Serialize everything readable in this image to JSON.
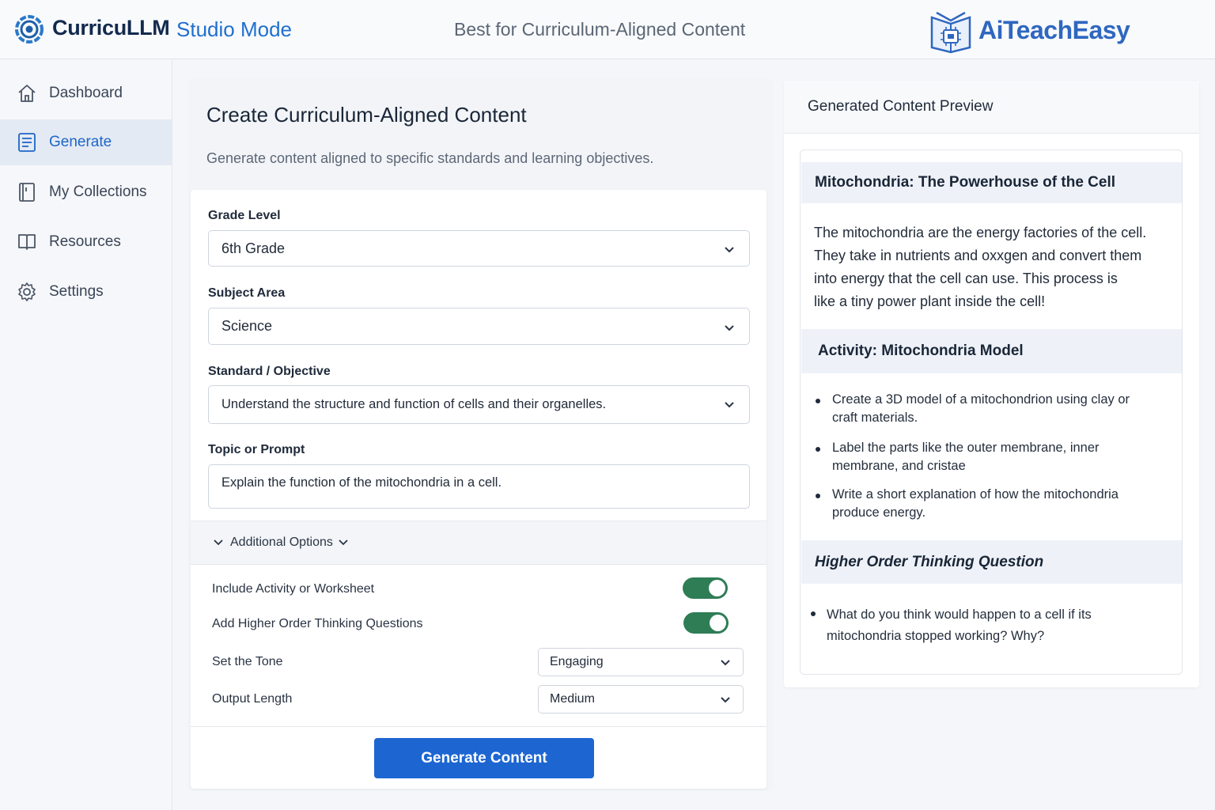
{
  "header": {
    "brand": "CurricuLLM",
    "mode": "Studio Mode",
    "tagline": "Best for Curriculum-Aligned Content",
    "partner": "AiTeachEasy"
  },
  "sidebar": {
    "items": [
      {
        "label": "Dashboard",
        "icon": "home-icon"
      },
      {
        "label": "Generate",
        "icon": "document-icon",
        "active": true
      },
      {
        "label": "My Collections",
        "icon": "book-icon"
      },
      {
        "label": "Resources",
        "icon": "open-book-icon"
      },
      {
        "label": "Settings",
        "icon": "gear-icon"
      }
    ]
  },
  "form": {
    "title": "Create Curriculum-Aligned Content",
    "subtitle": "Generate content aligned to specific standards and learning objectives.",
    "grade_label": "Grade Level",
    "grade_value": "6th Grade",
    "subject_label": "Subject Area",
    "subject_value": "Science",
    "standard_label": "Standard / Objective",
    "standard_value": "Understand the structure and function of cells and their organelles.",
    "topic_label": "Topic or Prompt",
    "topic_value": "Explain the function of the mitochondria in a cell.",
    "advanced_label": "Additional Options",
    "options": {
      "activity_label": "Include Activity or Worksheet",
      "activity_on": true,
      "hot_label": "Add Higher Order Thinking Questions",
      "hot_on": true,
      "tone_label": "Set the Tone",
      "tone_value": "Engaging",
      "length_label": "Output Length",
      "length_value": "Medium"
    },
    "generate_label": "Generate Content"
  },
  "preview": {
    "title": "Generated Content Preview",
    "section1_title": "Mitochondria: The Powerhouse of the Cell",
    "section1_lines": [
      "The mitochondria are the energy factories of the cell.",
      "They take in nutrients and oxxgen and convert them",
      "into energy that the cell can use. This process is",
      "like a tiny power plant inside the cell!"
    ],
    "section2_title": "Activity: Mitochondria Model",
    "activity_bullets": [
      [
        "Create a 3D model of a mitochondrion using clay or",
        "craft materials."
      ],
      [
        "Label the parts like the outer membrane, inner",
        "membrane, and cristae"
      ],
      [
        "Write a short explanation of how the mitochondria",
        "produce energy."
      ]
    ],
    "section3_title": "Higher Order Thinking Question",
    "question_lines": [
      "What do you think would happen to a cell if its",
      "mitochondria stopped working? Why?"
    ]
  },
  "colors": {
    "accent": "#1d66d2",
    "toggle_on": "#2e7d55",
    "brand_dark": "#132a4e"
  }
}
